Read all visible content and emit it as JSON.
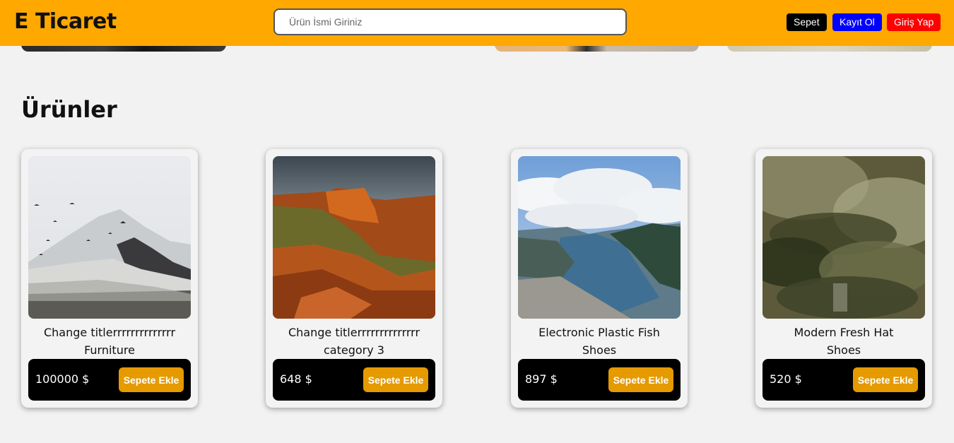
{
  "header": {
    "logo": "E Ticaret",
    "search_placeholder": "Ürün İsmi Giriniz",
    "cart_label": "Sepet",
    "register_label": "Kayıt Ol",
    "login_label": "Giriş Yap"
  },
  "section_title": "Ürünler",
  "products": [
    {
      "title": "Change titlerrrrrrrrrrrrrr",
      "category": "Furniture",
      "price": "100000 $",
      "add_label": "Sepete Ekle"
    },
    {
      "title": "Change titlerrrrrrrrrrrrrr",
      "category": "category 3",
      "price": "648 $",
      "add_label": "Sepete Ekle"
    },
    {
      "title": "Electronic Plastic Fish",
      "category": "Shoes",
      "price": "897 $",
      "add_label": "Sepete Ekle"
    },
    {
      "title": "Modern Fresh Hat",
      "category": "Shoes",
      "price": "520 $",
      "add_label": "Sepete Ekle"
    }
  ],
  "colors": {
    "header_bg": "#ffa800",
    "cart_button": "#000000",
    "register_button": "#0000ff",
    "login_button": "#ff0000",
    "add_button": "#e59a00"
  }
}
